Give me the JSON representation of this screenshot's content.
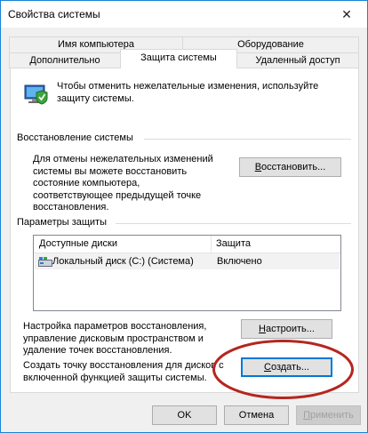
{
  "window": {
    "title": "Свойства системы",
    "close_symbol": "✕"
  },
  "tabs": {
    "row1": [
      "Имя компьютера",
      "Оборудование"
    ],
    "row2": [
      "Дополнительно",
      "Защита системы",
      "Удаленный доступ"
    ],
    "active": "Защита системы"
  },
  "intro": {
    "icon": "computer-shield-icon",
    "text": "Чтобы отменить нежелательные изменения, используйте защиту системы."
  },
  "restore": {
    "section_label": "Восстановление системы",
    "description": "Для отмены нежелательных изменений системы вы можете восстановить состояние компьютера, соответствующее предыдущей точке восстановления.",
    "button_underlined": "В",
    "button_rest": "осстановить..."
  },
  "protection": {
    "section_label": "Параметры защиты",
    "columns": [
      "Доступные диски",
      "Защита"
    ],
    "rows": [
      {
        "icon": "local-disk-icon",
        "drive": "Локальный диск (C:) (Система)",
        "status": "Включено"
      }
    ]
  },
  "configure": {
    "description": "Настройка параметров восстановления, управление дисковым пространством и удаление точек восстановления.",
    "button_underlined": "Н",
    "button_rest": "астроить..."
  },
  "create": {
    "description": "Создать точку восстановления для дисков с включенной функцией защиты системы.",
    "button_underlined": "С",
    "button_rest": "оздать..."
  },
  "footer": {
    "ok": "OK",
    "cancel": "Отмена",
    "apply_underlined": "П",
    "apply_rest": "рименить"
  },
  "colors": {
    "accent": "#0078d7",
    "annotation": "#b5261e"
  }
}
